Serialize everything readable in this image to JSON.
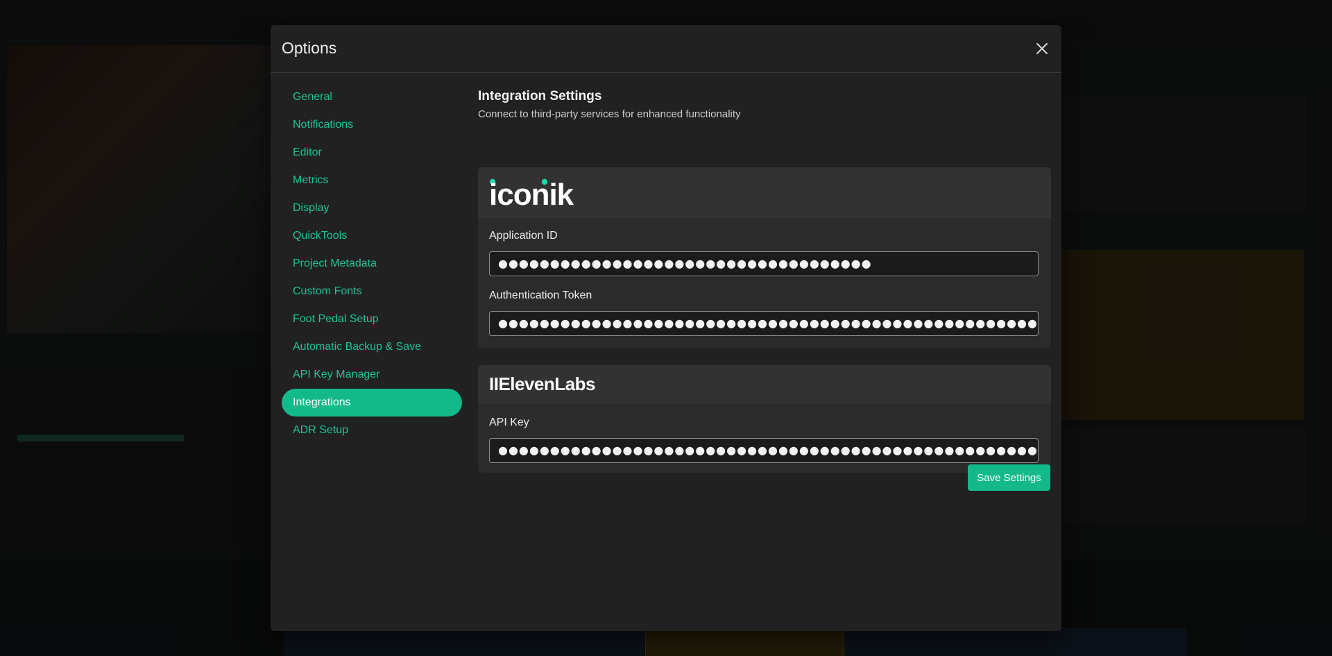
{
  "dialog": {
    "title": "Options",
    "close_icon": "close-icon"
  },
  "nav": {
    "items": [
      {
        "label": "General"
      },
      {
        "label": "Notifications"
      },
      {
        "label": "Editor"
      },
      {
        "label": "Metrics"
      },
      {
        "label": "Display"
      },
      {
        "label": "QuickTools"
      },
      {
        "label": "Project Metadata"
      },
      {
        "label": "Custom Fonts"
      },
      {
        "label": "Foot Pedal Setup"
      },
      {
        "label": "Automatic Backup & Save"
      },
      {
        "label": "API Key Manager"
      },
      {
        "label": "Integrations"
      },
      {
        "label": "ADR Setup"
      }
    ],
    "active": "Integrations"
  },
  "integrations": {
    "title": "Integration Settings",
    "subtitle": "Connect to third-party services for enhanced functionality",
    "iconik": {
      "logo": "iconik",
      "application_id_label": "Application ID",
      "application_id_value": "●●●●●●●●●●●●●●●●●●●●●●●●●●●●●●●●●●●●",
      "auth_token_label": "Authentication Token",
      "auth_token_value": "●●●●●●●●●●●●●●●●●●●●●●●●●●●●●●●●●●●●●●●●●●●●●●●●●●●●●●●●●●●●●●●●●●●●●●●●●●●●●●●●●●●●●●●●●●●●"
    },
    "elevenlabs": {
      "logo": "IIElevenLabs",
      "api_key_label": "API Key",
      "api_key_value": "●●●●●●●●●●●●●●●●●●●●●●●●●●●●●●●●●●●●●●●●●●●●●●●●●●●●●"
    },
    "save_label": "Save Settings"
  },
  "colors": {
    "accent": "#14b989",
    "nav_text": "#1fc497",
    "modal_bg": "#212121",
    "card_bg": "#2b2b2b"
  }
}
